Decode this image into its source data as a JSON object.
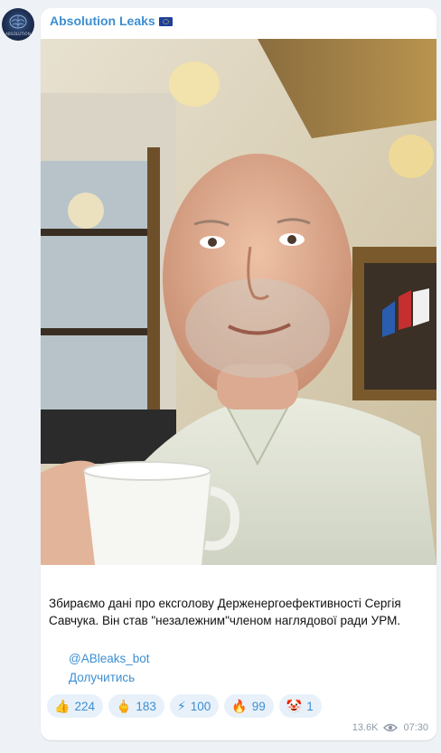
{
  "channel": {
    "name": "Absolution Leaks",
    "flag_icon": "eu-flag-icon",
    "avatar_text": "ABSOLUTION"
  },
  "post": {
    "photo_icon": "photo-selfie-man-with-coffee-cup",
    "text": "Збираємо дані про ексголову Держенергоефективності Сергія Савчука. Він став \"незалежним\"членом наглядової ради УРМ.",
    "bot_link": "@ABleaks_bot",
    "join_link": "Долучитись"
  },
  "reactions": [
    {
      "emoji": "👍",
      "icon": "thumbs-up-icon",
      "count": "224"
    },
    {
      "emoji": "🖕",
      "icon": "middle-finger-icon",
      "count": "183"
    },
    {
      "emoji": "⚡",
      "icon": "lightning-icon",
      "count": "100"
    },
    {
      "emoji": "🔥",
      "icon": "fire-icon",
      "count": "99"
    },
    {
      "emoji": "🤡",
      "icon": "clown-icon",
      "count": "1"
    }
  ],
  "meta": {
    "views": "13.6K",
    "time": "07:30"
  },
  "colors": {
    "link": "#3d8ed2",
    "bubble": "#ffffff",
    "background": "#eef1f5",
    "reaction_bg": "#e8f1fa"
  }
}
